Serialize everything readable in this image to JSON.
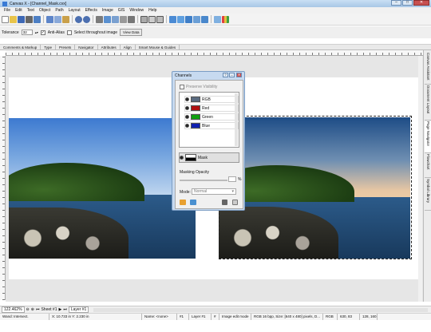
{
  "title_bar": {
    "title": "Canvas X - [Channel_Mask.cvx]"
  },
  "menu": [
    "File",
    "Edit",
    "Text",
    "Object",
    "Path",
    "Layout",
    "Effects",
    "Image",
    "GIS",
    "Window",
    "Help"
  ],
  "toolbar_icons": [
    "new-icon",
    "open-icon",
    "save-icon",
    "print-icon",
    "print-preview-icon",
    "cut-icon",
    "copy-icon",
    "paste-icon",
    "undo-icon",
    "redo-icon",
    "rotate-icon",
    "flip-icon",
    "align-icon",
    "distribute-icon",
    "group-icon",
    "ungroup-icon",
    "transform-icon",
    "lock-icon",
    "zoom-icon",
    "screen-icon",
    "image-icon",
    "layers-icon",
    "view-icon",
    "grid-icon",
    "chart-icon"
  ],
  "options": {
    "tolerance_label": "Tolerance",
    "tolerance_value": "32",
    "anti_alias": "Anti-Alias",
    "select_throughout": "Select throughout image",
    "view_data": "View Data"
  },
  "panel_tabs": [
    "Comments & Markup",
    "Type",
    "Presets",
    "Navigator",
    "Attributes",
    "Align",
    "Smart Mouse & Guides"
  ],
  "right_tabs": [
    "Canvas Assistant",
    "Document Layout",
    "Page Navigator",
    "Flowchart",
    "Symbol Library"
  ],
  "channels_dialog": {
    "title": "Channels",
    "preserve_visibility": "Preserve Visibility",
    "channels": [
      {
        "name": "RGB",
        "color": "#5a6b80"
      },
      {
        "name": "Red",
        "color": "#b01010"
      },
      {
        "name": "Green",
        "color": "#10a010"
      },
      {
        "name": "Blue",
        "color": "#1020b0"
      }
    ],
    "mask": {
      "name": "Mask"
    },
    "masking_opacity_label": "Masking Opacity",
    "opacity_unit": "%",
    "mode_label": "Mode:",
    "mode_value": "Normal"
  },
  "statusbar1": {
    "zoom": "122.462%",
    "sheet": "Sheet #1",
    "layer": "Layer #1"
  },
  "statusbar2": [
    "Wand: Intersect.",
    "X: 10.733 in  Y: 2.230 in",
    "Name: <none>",
    "#1",
    "Layer #1",
    "#",
    "Image edit mode",
    "RGB 16 bpp, Size: [640 x 480] pixels, D...",
    "RGB",
    "630, 83",
    "128, 160,"
  ]
}
